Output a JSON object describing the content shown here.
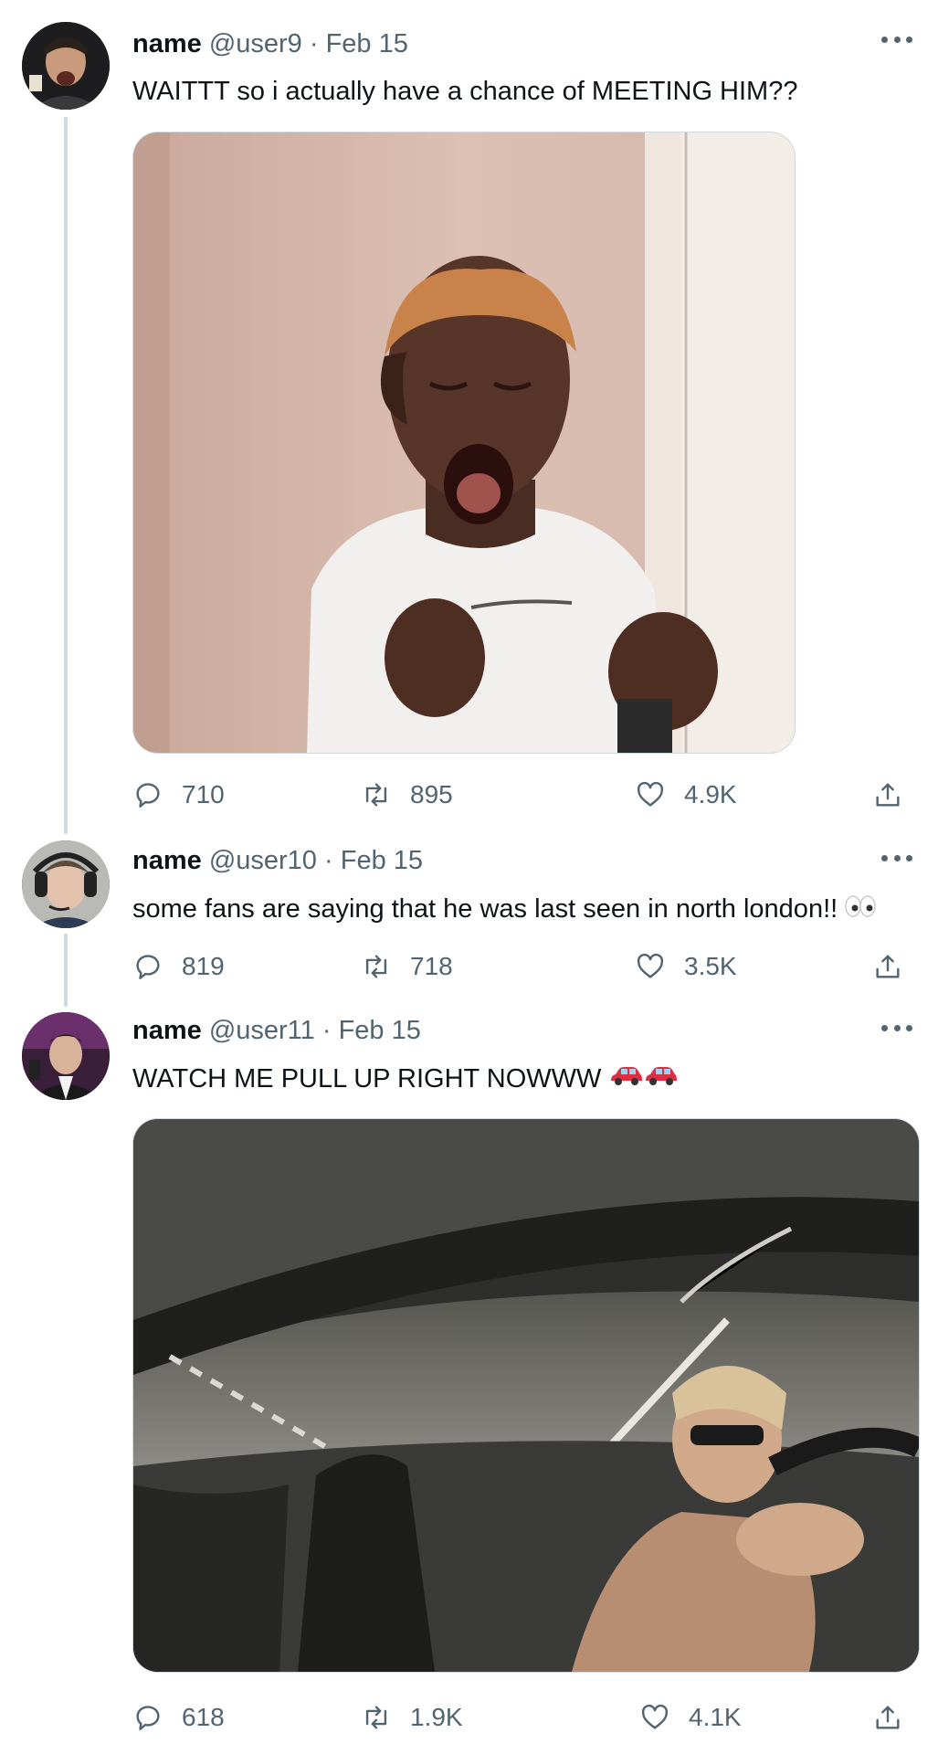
{
  "tweets": [
    {
      "name": "name",
      "handle": "@user9",
      "date": "Feb 15",
      "text": "WAITTT so i actually have a chance of MEETING HIM??",
      "replies": "710",
      "retweets": "895",
      "likes": "4.9K",
      "media": "crying-excited-girl-photo"
    },
    {
      "name": "name",
      "handle": "@user10",
      "date": "Feb 15",
      "text": "some fans are saying that he was last seen in north london!!",
      "emoji": "eyes-icon",
      "replies": "819",
      "retweets": "718",
      "likes": "3.5K"
    },
    {
      "name": "name",
      "handle": "@user11",
      "date": "Feb 15",
      "text": "WATCH ME PULL UP RIGHT NOWWW",
      "emoji": "car-icon",
      "replies": "618",
      "retweets": "1.9K",
      "likes": "4.1K",
      "media": "car-interior-driving-photo"
    }
  ],
  "separator": " · ",
  "colors": {
    "text": "#0f1419",
    "muted": "#536471",
    "border": "#cfd9de"
  }
}
